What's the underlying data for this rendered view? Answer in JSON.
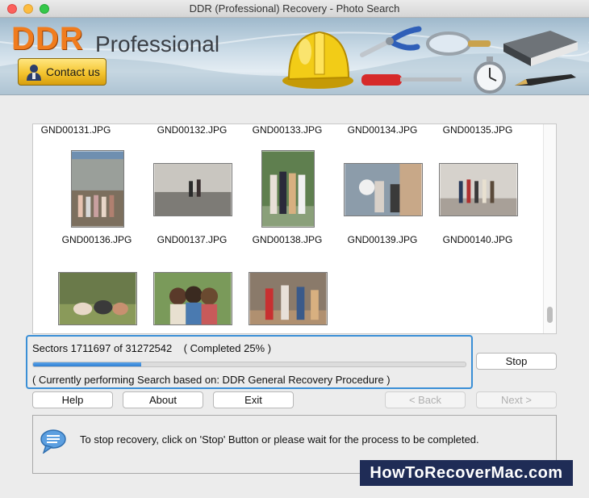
{
  "window": {
    "title": "DDR (Professional) Recovery - Photo Search"
  },
  "banner": {
    "logo_main": "DDR",
    "logo_sub": "Professional",
    "contact_label": "Contact us"
  },
  "results": {
    "row1_names": [
      "GND00131.JPG",
      "GND00132.JPG",
      "GND00133.JPG",
      "GND00134.JPG",
      "GND00135.JPG"
    ],
    "row2_names": [
      "GND00136.JPG",
      "GND00137.JPG",
      "GND00138.JPG",
      "GND00139.JPG",
      "GND00140.JPG"
    ]
  },
  "progress": {
    "sectors_text": "Sectors 1711697 of 31272542    ( Completed 25% )",
    "completed_fraction": 0.25,
    "current_text": "( Currently performing Search based on: DDR General Recovery Procedure )"
  },
  "buttons": {
    "stop": "Stop",
    "help": "Help",
    "about": "About",
    "exit": "Exit",
    "back": "< Back",
    "next": "Next >"
  },
  "info": {
    "message": "To stop recovery, click on 'Stop' Button or please wait for the process to be completed."
  },
  "watermark": "HowToRecoverMac.com",
  "colors": {
    "accent": "#3a8fd6",
    "logo_orange": "#f07c1e",
    "watermark_bg": "#1f2c56"
  }
}
